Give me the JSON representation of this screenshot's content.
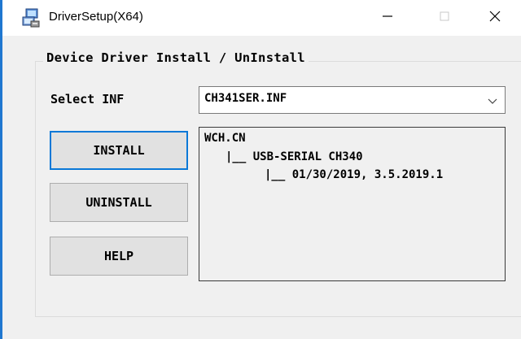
{
  "window": {
    "title": "DriverSetup(X64)",
    "controls": {
      "minimize": "—",
      "close": "✕"
    }
  },
  "group": {
    "label": "Device Driver Install / UnInstall"
  },
  "select": {
    "label": "Select INF",
    "value": "CH341SER.INF"
  },
  "buttons": {
    "install": "INSTALL",
    "uninstall": "UNINSTALL",
    "help": "HELP"
  },
  "info": {
    "lines": [
      "WCH.CN",
      "|__ USB-SERIAL CH340",
      "|__ 01/30/2019, 3.5.2019.1"
    ]
  },
  "colors": {
    "accent": "#0a78d7",
    "window_edge": "#1f77d0",
    "background": "#f0f0f0"
  }
}
